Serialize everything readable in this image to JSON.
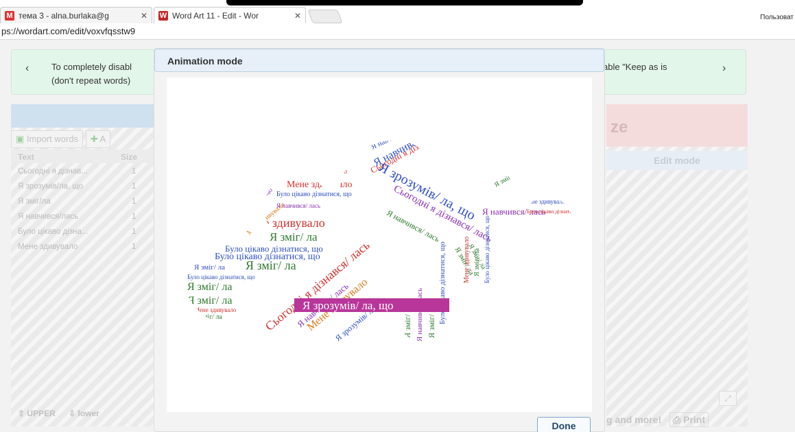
{
  "browser": {
    "tabs": [
      {
        "label": "тема 3 - alna.burlaka@g",
        "active": false
      },
      {
        "label": "Word Art 11 - Edit - Wor",
        "active": true
      }
    ],
    "close_glyph": "✕",
    "user_label": "Пользоват",
    "url_scheme": "ps://",
    "url_rest": "wordart.com/edit/voxvfqsstw9"
  },
  "notice": {
    "prev_glyph": "‹",
    "next_glyph": "›",
    "line1": "To completely disabl",
    "line2": "(don't repeat words)",
    "right_text": "able \"Keep as is"
  },
  "left_panel": {
    "import_label": "Import words",
    "add_partial": "A",
    "col_text": "Text",
    "col_size": "Size",
    "words": [
      {
        "text": "Сьогодні я дізнав...",
        "size": "1"
      },
      {
        "text": "Я зрозумів/ла, що",
        "size": "1"
      },
      {
        "text": "Я зміг/ла",
        "size": "1"
      },
      {
        "text": "Я навчився/лась",
        "size": "1"
      },
      {
        "text": "Було цікаво дізна...",
        "size": "1"
      },
      {
        "text": "Мене здивувало",
        "size": "1"
      }
    ],
    "upper_label": "UPPER",
    "lower_label": "lower"
  },
  "right_panel": {
    "header_partial": "ze",
    "edit_mode_label": "Edit mode",
    "bottom_text": "g and more!",
    "print_label": "Print"
  },
  "modal": {
    "title": "Animation mode",
    "done_label": "Done",
    "highlight_word": "Я зрозумів/ ла, що",
    "words": {
      "w1": "Я зрозумів/ ла, що",
      "w2": "Я навчився/ лась",
      "w3": "Сьогодні я дізнався/ лась",
      "w4": "Мене здивувало",
      "w5": "Я зміг/ ла",
      "w6": "Було цікаво дізнатися, що"
    }
  },
  "colors": {
    "notice_bg": "#e3f6ea",
    "modal_header_bg": "#e7f0f8",
    "highlight_bg": "#b8369a",
    "word_red": "#d0312d",
    "word_blue": "#2f4fc4",
    "word_green": "#2c7a2c",
    "word_purple": "#8a2fb0",
    "word_orange": "#d97a1a"
  }
}
